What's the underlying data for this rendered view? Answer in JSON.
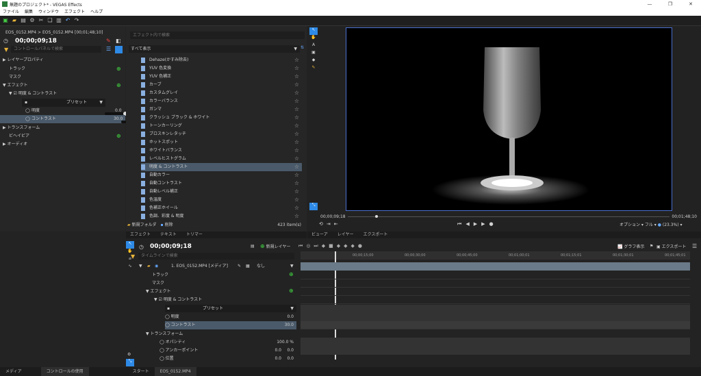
{
  "window": {
    "title": "無題のプロジェクト* - VEGAS Effects"
  },
  "menu": [
    "ファイル",
    "編集",
    "ウィンドウ",
    "エフェクト",
    "ヘルプ"
  ],
  "left": {
    "clip_path": "EOS_0152.MP4 > EOS_0152.MP4 [00;01;48;10]",
    "timecode": "00;00;09;18",
    "search_placeholder": "コントロールパネルで検索",
    "items": {
      "layer": "レイヤープロパティ",
      "track": "トラック",
      "mask": "マスク",
      "effect": "エフェクト",
      "bc": "明度 & コントラスト",
      "preset": "プリセット",
      "brightness": "明度",
      "brightness_val": "0.0",
      "contrast": "コントラスト",
      "contrast_val": "30.0",
      "transform": "トランスフォーム",
      "behavior": "ビヘイビア",
      "audio": "オーディオ"
    }
  },
  "mid": {
    "search_placeholder": "エフェクト内で検索",
    "filter": "すべて表示",
    "folder": "新規フォルダ",
    "delete": "削除",
    "count": "423 item(s)",
    "effects": [
      "Dehaze(かすみ除去)",
      "YUV 色変換",
      "YUV 色補正",
      "カーブ",
      "カスタムグレイ",
      "カラーバランス",
      "ガンマ",
      "クラッシュ ブラック & ホワイト",
      "トーンカーリング",
      "ブロスキンレタッチ",
      "ホットスポット",
      "ホワイトバランス",
      "レベルヒストグラム",
      "明度 & コントラスト",
      "自動カラー",
      "自動コントラスト",
      "自動レベル補正",
      "色温度",
      "色補正ホイール",
      "色調、彩度 & 明度"
    ],
    "tabs": [
      "エフェクト",
      "テキスト",
      "トリマー"
    ]
  },
  "right": {
    "start_tc": "00;00;09;18",
    "end_tc": "00;01;48;10",
    "option": "オプション",
    "full": "フル",
    "zoom": "(23.3%)",
    "tabs": [
      "ビューア",
      "レイヤー",
      "エクスポート"
    ]
  },
  "timeline": {
    "timecode": "00;00;09;18",
    "new_layer": "新規レイヤー",
    "search_placeholder": "タイムラインで検索",
    "graph": "グラフ表示",
    "export": "エクスポート",
    "layer_name": "1. EOS_0152.MP4 [メディア]",
    "blend": "なし",
    "track": "トラック",
    "mask": "マスク",
    "effect": "エフェクト",
    "bc": "明度 & コントラスト",
    "preset": "プリセット",
    "brightness": "明度",
    "brightness_val": "0.0",
    "contrast": "コントラスト",
    "contrast_val": "30.0",
    "transform": "トランスフォーム",
    "opacity": "オパシティ",
    "opacity_val": "100.0 %",
    "anchor": "アンカーポイント",
    "anchor_x": "0.0",
    "anchor_y": "0.0",
    "position": "位置",
    "position_x": "0.0",
    "position_y": "0.0",
    "ruler": [
      "00;00;15;00",
      "00;00;30;00",
      "00;00;45;00",
      "00;01;00;01",
      "00;01;15;01",
      "00;01;30;01",
      "00;01;45;01"
    ]
  },
  "bottom": {
    "tabs": [
      "メディア",
      "コントロールの使用",
      "スタート",
      "EOS_0152.MP4"
    ]
  }
}
